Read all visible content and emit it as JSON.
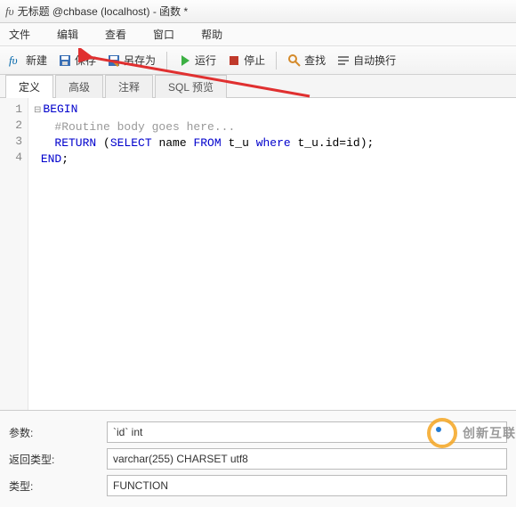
{
  "window": {
    "icon_label": "fυ",
    "title": "无标题 @chbase (localhost) - 函数 *"
  },
  "menu": {
    "file": "文件",
    "edit": "编辑",
    "view": "查看",
    "window": "窗口",
    "help": "帮助"
  },
  "toolbar": {
    "new": "新建",
    "save": "保存",
    "save_as": "另存为",
    "run": "运行",
    "stop": "停止",
    "find": "查找",
    "wrap": "自动换行"
  },
  "tabs": {
    "definition": "定义",
    "advanced": "高级",
    "comment": "注释",
    "sql_preview": "SQL 预览"
  },
  "code": {
    "lines": [
      "1",
      "2",
      "3",
      "4"
    ],
    "l1_kw": "BEGIN",
    "l2_cm": "#Routine body goes here...",
    "l3_kw1": "RETURN",
    "l3_txt1": " (",
    "l3_kw2": "SELECT",
    "l3_txt2": " name ",
    "l3_kw3": "FROM",
    "l3_txt3": " t_u ",
    "l3_kw4": "where",
    "l3_txt4": " t_u.id=id);",
    "l4_kw": "END",
    "l4_txt": ";"
  },
  "props": {
    "params_label": "参数:",
    "params_value": "`id` int",
    "return_label": "返回类型:",
    "return_value": "varchar(255) CHARSET utf8",
    "type_label": "类型:",
    "type_value": "FUNCTION"
  },
  "watermark": "创新互联"
}
